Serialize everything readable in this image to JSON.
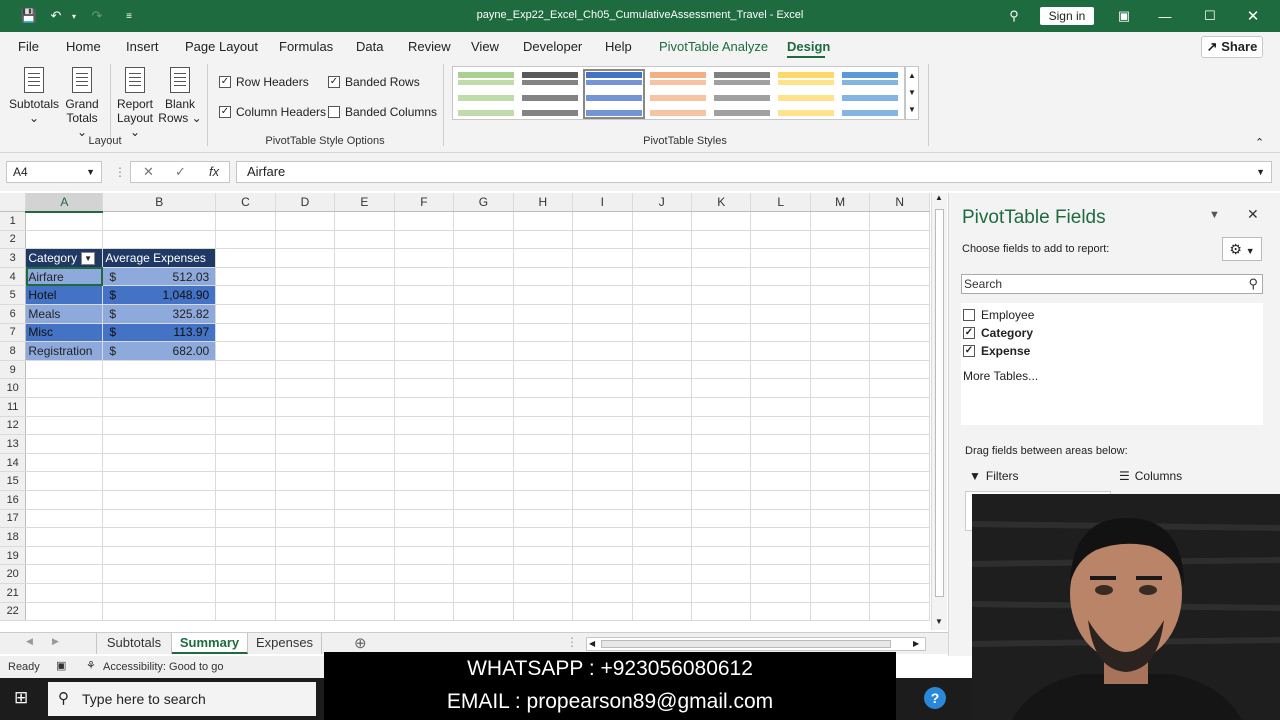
{
  "window": {
    "title": "payne_Exp22_Excel_Ch05_CumulativeAssessment_Travel  -  Excel",
    "signin": "Sign in"
  },
  "menu": {
    "items": [
      "File",
      "Home",
      "Insert",
      "Page Layout",
      "Formulas",
      "Data",
      "Review",
      "View",
      "Developer",
      "Help",
      "PivotTable Analyze",
      "Design"
    ],
    "active": "Design",
    "share": "Share"
  },
  "ribbon": {
    "layout_group": {
      "label": "Layout",
      "subtotals": "Subtotals",
      "grand_totals": [
        "Grand",
        "Totals ⌄"
      ],
      "report_layout": [
        "Report",
        "Layout ⌄"
      ],
      "blank_rows": [
        "Blank",
        "Rows ⌄"
      ]
    },
    "style_options": {
      "label": "PivotTable Style Options",
      "row_headers": "Row Headers",
      "column_headers": "Column Headers",
      "banded_rows": "Banded Rows",
      "banded_columns": "Banded Columns"
    },
    "styles_label": "PivotTable Styles",
    "swatch_colors": [
      "#a9d08e",
      "#595959",
      "#4472c4",
      "#f4b084",
      "#808080",
      "#ffd966",
      "#5b9bd5"
    ]
  },
  "formula_bar": {
    "name_box": "A4",
    "fx": "fx",
    "content": "Airfare"
  },
  "grid": {
    "columns": [
      "A",
      "B",
      "C",
      "D",
      "E",
      "F",
      "G",
      "H",
      "I",
      "J",
      "K",
      "L",
      "M",
      "N"
    ],
    "rows": [
      "1",
      "2",
      "3",
      "4",
      "5",
      "6",
      "7",
      "8",
      "9",
      "10",
      "11",
      "12",
      "13",
      "14",
      "15",
      "16",
      "17",
      "18",
      "19",
      "20",
      "21",
      "22"
    ],
    "pivot": {
      "header_category": "Category",
      "header_value": "Average Expenses",
      "currency": "$",
      "rows": [
        {
          "category": "Airfare",
          "value": "512.03"
        },
        {
          "category": "Hotel",
          "value": "1,048.90"
        },
        {
          "category": "Meals",
          "value": "325.82"
        },
        {
          "category": "Misc",
          "value": "113.97"
        },
        {
          "category": "Registration",
          "value": "682.00"
        }
      ]
    }
  },
  "sheets": {
    "tabs": [
      "Subtotals",
      "Summary",
      "Expenses"
    ],
    "active": "Summary"
  },
  "status": {
    "ready": "Ready",
    "accessibility": "Accessibility: Good to go"
  },
  "taskbar": {
    "search_placeholder": "Type here to search"
  },
  "overlay": {
    "line1": "WHATSAPP :     +923056080612",
    "line2": "EMAIL :   propearson89@gmail.com"
  },
  "pivot_pane": {
    "title": "PivotTable Fields",
    "subtitle": "Choose fields to add to report:",
    "search_placeholder": "Search",
    "fields": [
      {
        "name": "Employee",
        "checked": false
      },
      {
        "name": "Category",
        "checked": true
      },
      {
        "name": "Expense",
        "checked": true
      }
    ],
    "more_tables": "More Tables...",
    "drag_label": "Drag fields between areas below:",
    "filters": "Filters",
    "columns": "Columns"
  }
}
